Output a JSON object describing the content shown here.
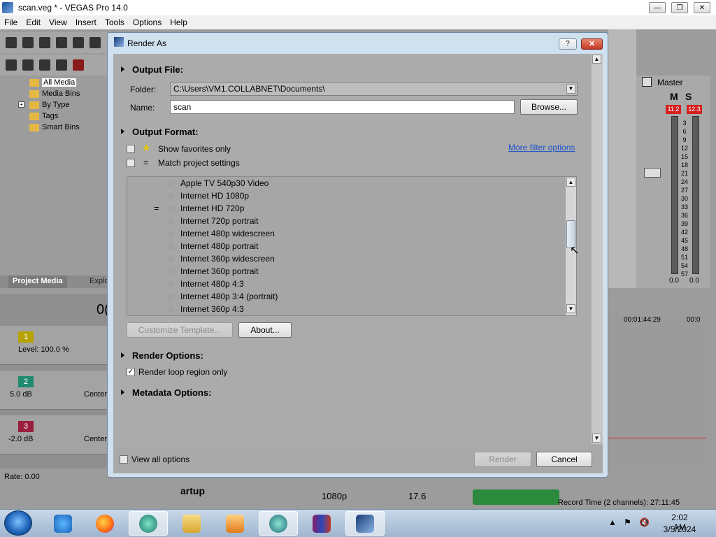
{
  "app": {
    "title": "scan.veg * - VEGAS Pro 14.0",
    "window_controls": [
      "minimize",
      "restore",
      "close"
    ]
  },
  "menubar": [
    "File",
    "Edit",
    "View",
    "Insert",
    "Tools",
    "Options",
    "Help"
  ],
  "media_tree": {
    "items": [
      "All Media",
      "Media Bins",
      "By Type",
      "Tags",
      "Smart Bins"
    ],
    "selected": "All Media"
  },
  "bottom_tabs": [
    "Project Media",
    "Explo"
  ],
  "tracks": [
    {
      "number": "1",
      "label": "Level: 100.0 %",
      "color": "#b8a200"
    },
    {
      "number": "2",
      "label": "5.0 dB",
      "center": "Center",
      "color": "#1f8a6e"
    },
    {
      "number": "3",
      "label": "-2.0 dB",
      "center": "Center",
      "color": "#9a1f3e"
    }
  ],
  "rate": "Rate: 0.00",
  "master": {
    "title": "Master",
    "peak_left": "11.2",
    "peak_right": "12.3",
    "scale": [
      "3",
      "6",
      "9",
      "12",
      "15",
      "18",
      "21",
      "24",
      "27",
      "30",
      "33",
      "36",
      "39",
      "42",
      "45",
      "48",
      "51",
      "54",
      "57"
    ],
    "readout_left": "0.0",
    "readout_right": "0.0"
  },
  "timeline": {
    "timecodes": [
      "00:01:44:29",
      "00:0"
    ]
  },
  "record_time": "Record Time (2 channels): 27:11:45",
  "background_labels": {
    "startup": "artup",
    "res": "1080p",
    "fps": "17.6",
    "counter": "0("
  },
  "dialog": {
    "title": "Render As",
    "help_label": "?",
    "close_label": "✕",
    "output_file": {
      "heading": "Output File:",
      "folder_label": "Folder:",
      "folder_value": "C:\\Users\\VM1.COLLABNET\\Documents\\",
      "name_label": "Name:",
      "name_value": "scan",
      "browse_label": "Browse..."
    },
    "output_format": {
      "heading": "Output Format:",
      "show_favorites": "Show favorites only",
      "match_project": "Match project settings",
      "more_filter": "More filter options",
      "templates": [
        {
          "name": "Apple TV 540p30 Video",
          "match": false
        },
        {
          "name": "Internet HD 1080p",
          "match": false
        },
        {
          "name": "Internet HD 720p",
          "match": true
        },
        {
          "name": "Internet 720p portrait",
          "match": false
        },
        {
          "name": "Internet 480p widescreen",
          "match": false
        },
        {
          "name": "Internet 480p portrait",
          "match": false
        },
        {
          "name": "Internet 360p widescreen",
          "match": false
        },
        {
          "name": "Internet 360p portrait",
          "match": false
        },
        {
          "name": "Internet 480p 4:3",
          "match": false
        },
        {
          "name": "Internet 480p 3:4 (portrait)",
          "match": false
        },
        {
          "name": "Internet 360p 4:3",
          "match": false
        }
      ],
      "customize_label": "Customize Template...",
      "about_label": "About..."
    },
    "render_options": {
      "heading": "Render Options:",
      "loop_region": "Render loop region only",
      "loop_checked": true
    },
    "metadata_options": {
      "heading": "Metadata Options:"
    },
    "footer": {
      "view_all": "View all options",
      "render_label": "Render",
      "cancel_label": "Cancel"
    }
  },
  "taskbar": {
    "time": "2:02 AM",
    "date": "3/5/2024"
  }
}
